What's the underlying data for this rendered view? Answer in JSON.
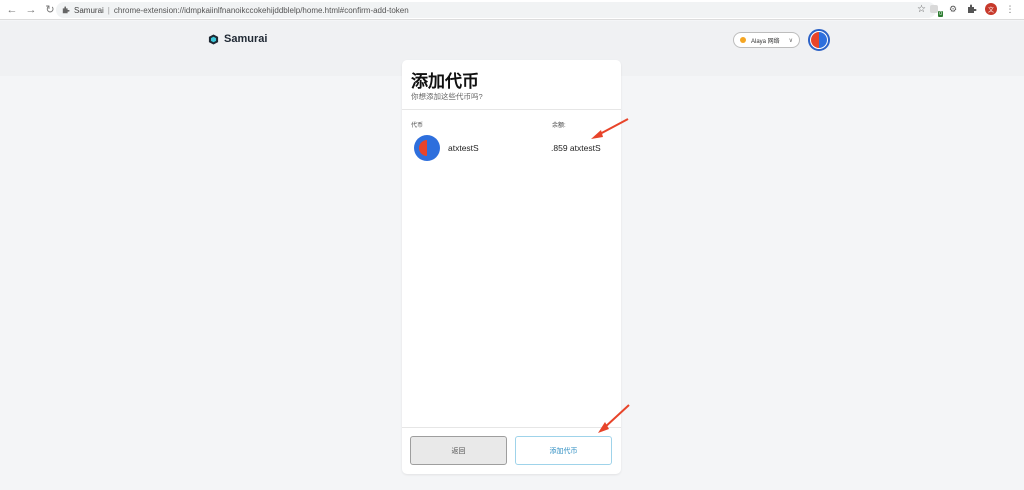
{
  "browser": {
    "tab_title": "Samurai",
    "url": "chrome-extension://idmpkaiinlfnanoikccokehijddblelp/home.html#confirm-add-token",
    "ext_badge": "0",
    "profile_initial": "文"
  },
  "header": {
    "brand": "Samurai",
    "network_label": "Alaya 网络"
  },
  "card": {
    "title": "添加代币",
    "subtitle": "你想添加这些代币吗?",
    "col_token": "代币",
    "col_balance": "余额:",
    "tokens": [
      {
        "name": "atxtestS",
        "balance": ".859 atxtestS"
      }
    ]
  },
  "footer": {
    "back_label": "返回",
    "add_label": "添加代币"
  },
  "colors": {
    "accent": "#2f8ec2",
    "network_dot": "#f5a623",
    "arrow": "#e8442a"
  }
}
